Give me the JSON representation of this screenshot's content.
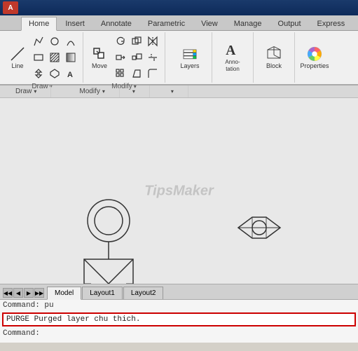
{
  "titlebar": {
    "logo": "A"
  },
  "ribbon": {
    "tabs": [
      {
        "label": "Home",
        "active": true
      },
      {
        "label": "Insert",
        "active": false
      },
      {
        "label": "Annotate",
        "active": false
      },
      {
        "label": "Parametric",
        "active": false
      },
      {
        "label": "View",
        "active": false
      },
      {
        "label": "Manage",
        "active": false
      },
      {
        "label": "Output",
        "active": false
      },
      {
        "label": "Express",
        "active": false
      }
    ],
    "groups": {
      "draw": {
        "label": "Draw"
      },
      "modify": {
        "label": "Modify"
      },
      "layers": {
        "label": "Layers"
      },
      "annotation": {
        "label": "Anno-\ntation"
      },
      "block": {
        "label": "Block"
      },
      "properties": {
        "label": "Properties"
      }
    }
  },
  "panel_labels": [
    {
      "label": "Draw",
      "has_arrow": true
    },
    {
      "label": "Modify",
      "has_arrow": true
    },
    {
      "label": "",
      "has_arrow": true
    },
    {
      "label": "",
      "has_arrow": true
    }
  ],
  "watermark": "TipsMaker",
  "drawing_tabs": [
    {
      "label": "Model",
      "active": true
    },
    {
      "label": "Layout1",
      "active": false
    },
    {
      "label": "Layout2",
      "active": false
    }
  ],
  "commands": [
    {
      "text": "Command: pu"
    },
    {
      "text": "PURGE Purged layer chu thich.",
      "highlighted": true
    },
    {
      "text": "Command:"
    }
  ]
}
